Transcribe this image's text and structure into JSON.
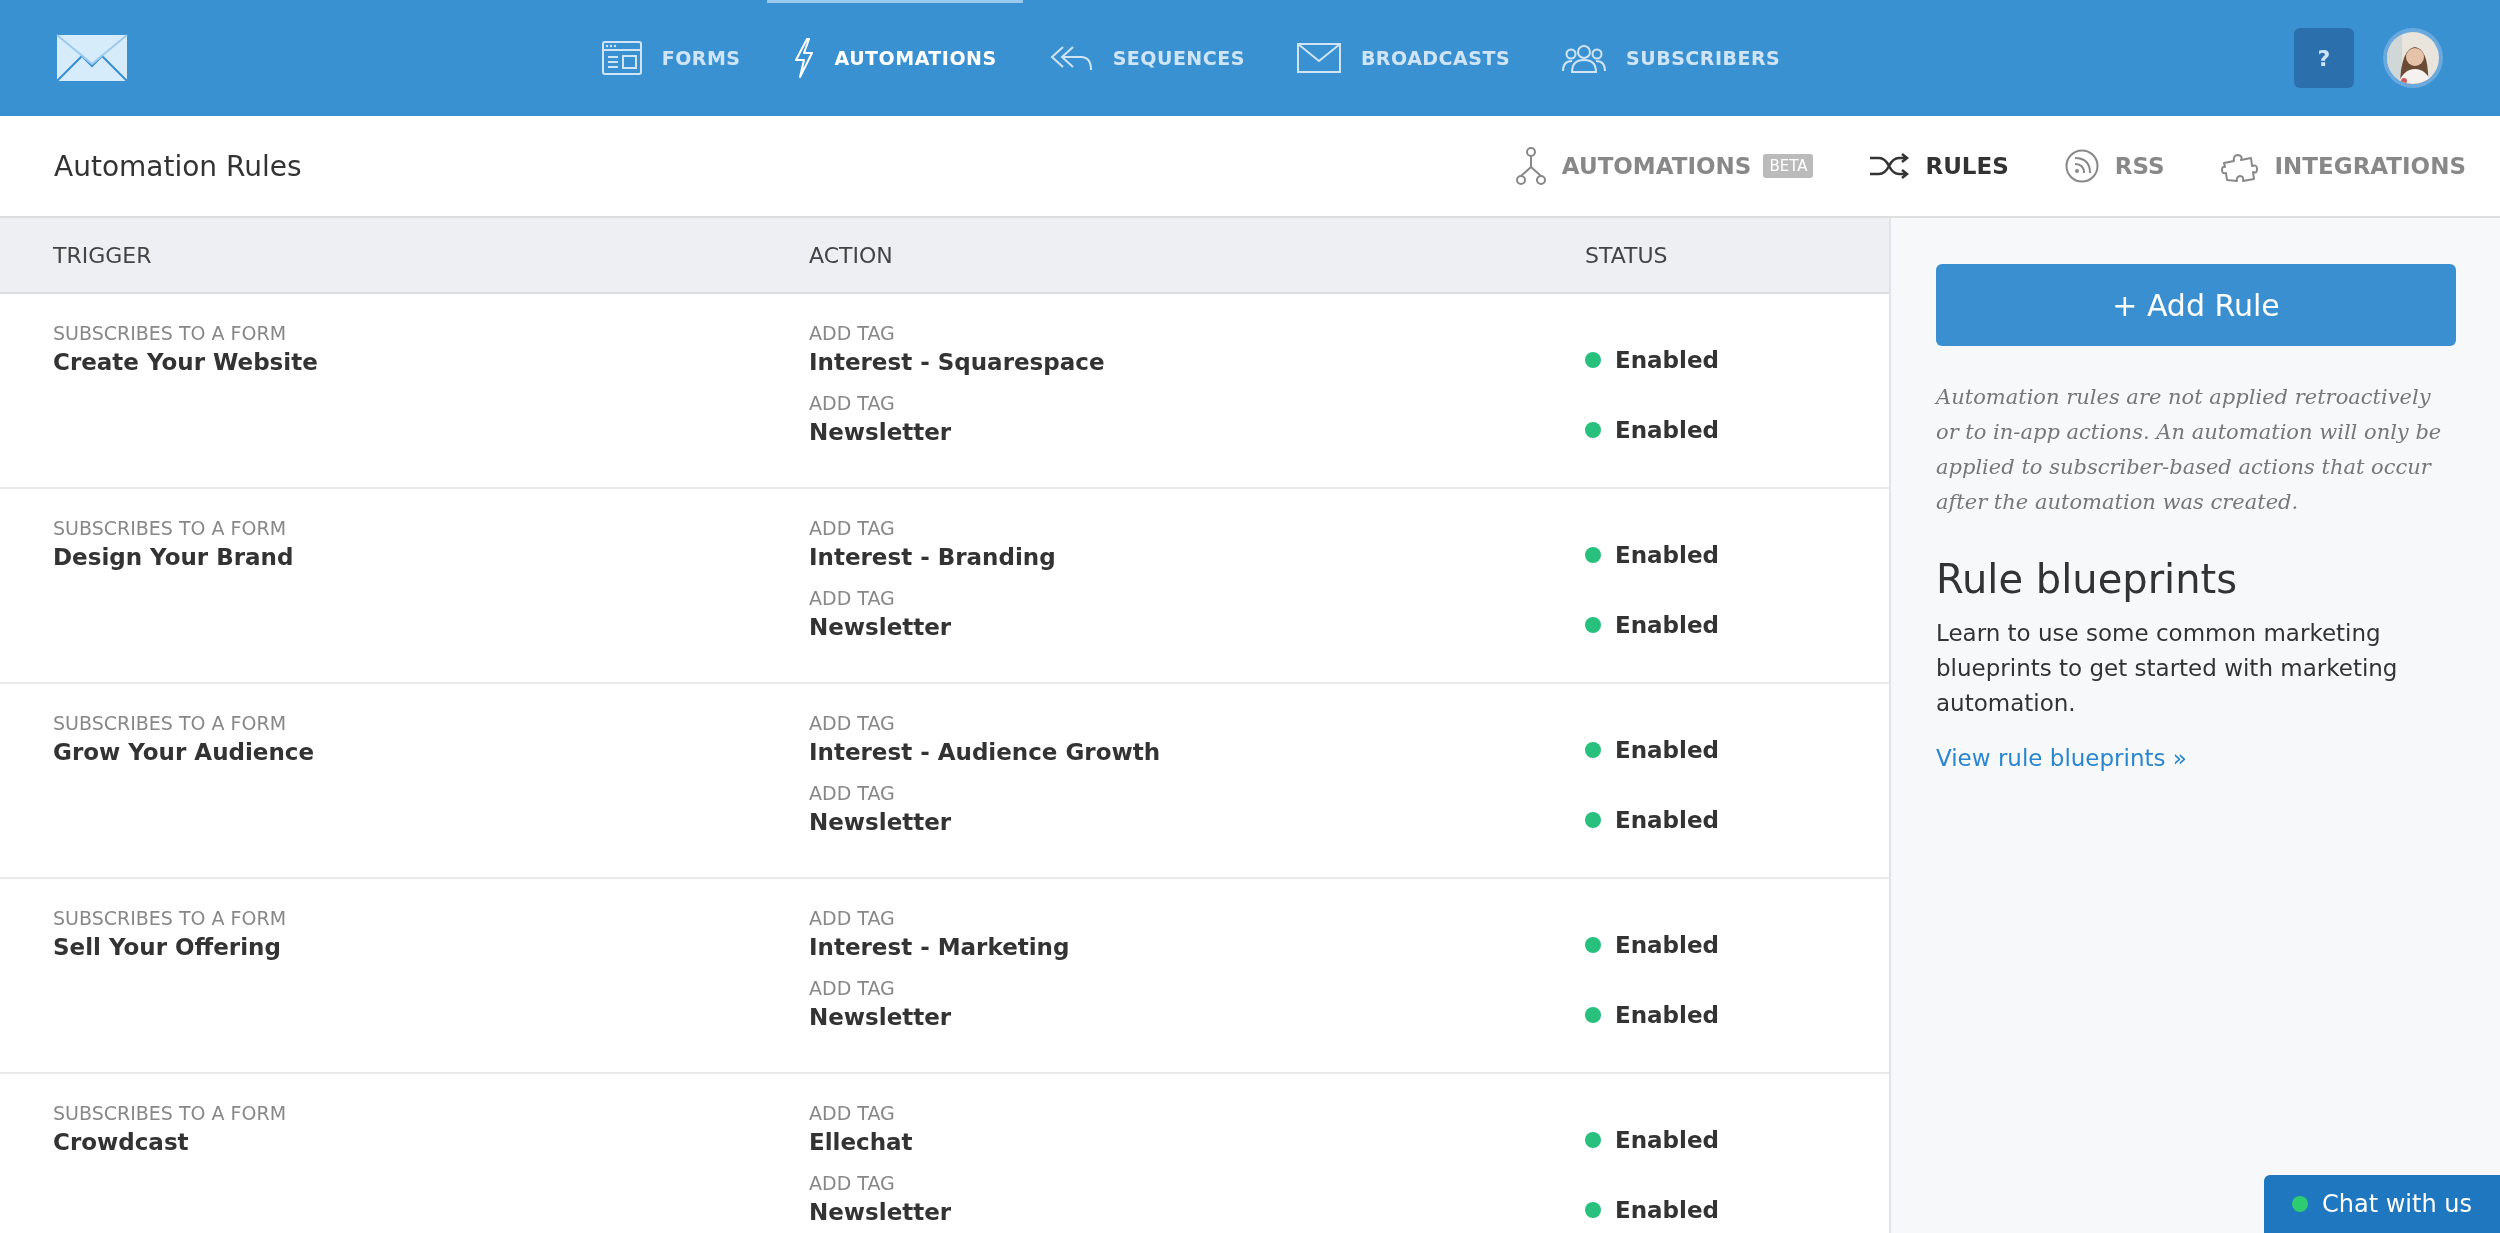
{
  "nav": {
    "items": [
      {
        "label": "FORMS",
        "selected": false
      },
      {
        "label": "AUTOMATIONS",
        "selected": true
      },
      {
        "label": "SEQUENCES",
        "selected": false
      },
      {
        "label": "BROADCASTS",
        "selected": false
      },
      {
        "label": "SUBSCRIBERS",
        "selected": false
      }
    ],
    "help": "?"
  },
  "page_title": "Automation Rules",
  "subnav": [
    {
      "label": "AUTOMATIONS",
      "badge": "BETA",
      "selected": false
    },
    {
      "label": "RULES",
      "selected": true
    },
    {
      "label": "RSS",
      "selected": false
    },
    {
      "label": "INTEGRATIONS",
      "selected": false
    }
  ],
  "table": {
    "columns": [
      "TRIGGER",
      "ACTION",
      "STATUS"
    ],
    "rows": [
      {
        "trigger_type": "SUBSCRIBES TO A FORM",
        "trigger": "Create Your Website",
        "actions": [
          {
            "type": "ADD TAG",
            "value": "Interest - Squarespace",
            "status": "Enabled"
          },
          {
            "type": "ADD TAG",
            "value": "Newsletter",
            "status": "Enabled"
          }
        ]
      },
      {
        "trigger_type": "SUBSCRIBES TO A FORM",
        "trigger": "Design Your Brand",
        "actions": [
          {
            "type": "ADD TAG",
            "value": "Interest - Branding",
            "status": "Enabled"
          },
          {
            "type": "ADD TAG",
            "value": "Newsletter",
            "status": "Enabled"
          }
        ]
      },
      {
        "trigger_type": "SUBSCRIBES TO A FORM",
        "trigger": "Grow Your Audience",
        "actions": [
          {
            "type": "ADD TAG",
            "value": "Interest - Audience Growth",
            "status": "Enabled"
          },
          {
            "type": "ADD TAG",
            "value": "Newsletter",
            "status": "Enabled"
          }
        ]
      },
      {
        "trigger_type": "SUBSCRIBES TO A FORM",
        "trigger": "Sell Your Offering",
        "actions": [
          {
            "type": "ADD TAG",
            "value": "Interest - Marketing",
            "status": "Enabled"
          },
          {
            "type": "ADD TAG",
            "value": "Newsletter",
            "status": "Enabled"
          }
        ]
      },
      {
        "trigger_type": "SUBSCRIBES TO A FORM",
        "trigger": "Crowdcast",
        "actions": [
          {
            "type": "ADD TAG",
            "value": "Ellechat",
            "status": "Enabled"
          },
          {
            "type": "ADD TAG",
            "value": "Newsletter",
            "status": "Enabled"
          }
        ]
      }
    ]
  },
  "sidebar": {
    "button": "+ Add Rule",
    "note": "Automation rules are not applied retroactively or to in-app actions. An automation will only be applied to subscriber-based actions that occur after the automation was created.",
    "heading": "Rule blueprints",
    "text": "Learn to use some common marketing blueprints to get started with marketing automation.",
    "link": "View rule blueprints »"
  },
  "chat": "Chat with us"
}
